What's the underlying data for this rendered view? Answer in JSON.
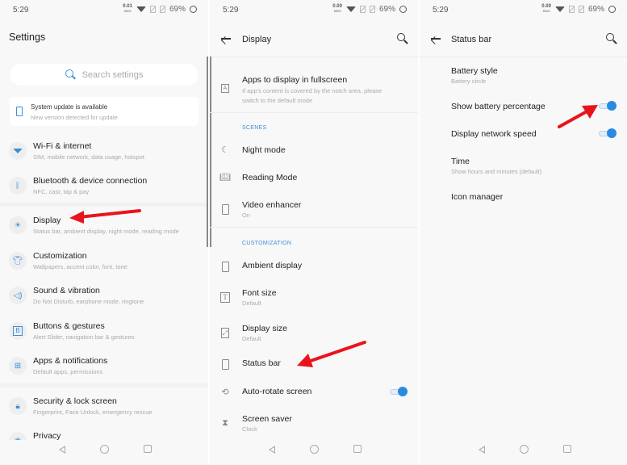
{
  "status_bars": [
    {
      "time": "5:29",
      "net_speed": "0.01",
      "net_unit": "KB/S",
      "battery": "69%"
    },
    {
      "time": "5:29",
      "net_speed": "0.00",
      "net_unit": "KB/S",
      "battery": "69%"
    },
    {
      "time": "5:29",
      "net_speed": "0.00",
      "net_unit": "KB/S",
      "battery": "69%"
    }
  ],
  "settings": {
    "title": "Settings",
    "search_placeholder": "Search settings",
    "update_card": {
      "title": "System update is available",
      "subtitle": "New version detected for update",
      "icon": "phone-update-icon"
    },
    "items": [
      {
        "icon": "wifi-icon",
        "title": "Wi-Fi & internet",
        "subtitle": "SIM, mobile network, data usage, hotspot"
      },
      {
        "icon": "bluetooth-icon",
        "title": "Bluetooth & device connection",
        "subtitle": "NFC, cast, tap & pay"
      },
      {
        "icon": "brightness-icon",
        "title": "Display",
        "subtitle": "Status bar, ambient display, night mode, reading mode"
      },
      {
        "icon": "tshirt-icon",
        "title": "Customization",
        "subtitle": "Wallpapers, accent color, font, tone"
      },
      {
        "icon": "speaker-icon",
        "title": "Sound & vibration",
        "subtitle": "Do Not Disturb, earphone mode, ringtone"
      },
      {
        "icon": "button-b-icon",
        "title": "Buttons & gestures",
        "subtitle": "Alert Slider, navigation bar & gestures"
      },
      {
        "icon": "apps-grid-icon",
        "title": "Apps & notifications",
        "subtitle": "Default apps, permissions"
      },
      {
        "icon": "lock-icon",
        "title": "Security & lock screen",
        "subtitle": "Fingerprint, Face Unlock, emergency rescue"
      },
      {
        "icon": "privacy-icon",
        "title": "Privacy",
        "subtitle": ""
      }
    ]
  },
  "display": {
    "title": "Display",
    "fullscreen": {
      "title": "Apps to display in fullscreen",
      "subtitle_line1": "If app's content is covered by the notch area, please",
      "subtitle_line2": "switch to the default mode"
    },
    "section_scenes": "SCENES",
    "scenes": [
      {
        "icon": "moon-icon",
        "title": "Night mode",
        "subtitle": ""
      },
      {
        "icon": "book-icon",
        "title": "Reading Mode",
        "subtitle": ""
      },
      {
        "icon": "video-enhancer-icon",
        "title": "Video enhancer",
        "subtitle": "On"
      }
    ],
    "section_custom": "CUSTOMIZATION",
    "custom": [
      {
        "icon": "ambient-display-icon",
        "title": "Ambient display",
        "subtitle": ""
      },
      {
        "icon": "font-size-icon",
        "title": "Font size",
        "subtitle": "Default"
      },
      {
        "icon": "display-size-icon",
        "title": "Display size",
        "subtitle": "Default"
      },
      {
        "icon": "phone-outline-icon",
        "title": "Status bar",
        "subtitle": ""
      },
      {
        "icon": "rotate-icon",
        "title": "Auto-rotate screen",
        "subtitle": "",
        "toggle": true
      },
      {
        "icon": "hourglass-icon",
        "title": "Screen saver",
        "subtitle": "Clock"
      }
    ]
  },
  "status_bar_page": {
    "title": "Status bar",
    "items": [
      {
        "title": "Battery style",
        "subtitle": "Battery circle"
      },
      {
        "title": "Show battery percentage",
        "subtitle": "",
        "toggle": true
      },
      {
        "title": "Display network speed",
        "subtitle": "",
        "toggle": true
      },
      {
        "title": "Time",
        "subtitle": "Show hours and minutes (default)"
      },
      {
        "title": "Icon manager",
        "subtitle": ""
      }
    ]
  },
  "colors": {
    "accent": "#2a8ae0",
    "annotation_arrow": "#e8141b"
  }
}
